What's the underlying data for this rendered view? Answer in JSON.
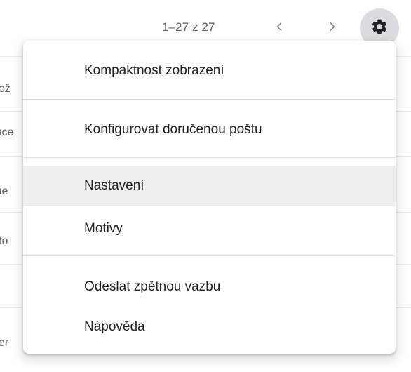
{
  "toolbar": {
    "pagination_text": "1–27 z 27",
    "prev_icon": "chevron-left-icon",
    "next_icon": "chevron-right-icon",
    "settings_icon": "gear-icon"
  },
  "background_list": {
    "row_fragments": [
      "ož",
      "ıce",
      "ıe",
      "fo",
      "",
      "er"
    ]
  },
  "menu": {
    "items": [
      {
        "label": "Kompaktnost zobrazení"
      },
      {
        "label": "Konfigurovat doručenou poštu"
      },
      {
        "label": "Nastavení",
        "highlighted": true
      },
      {
        "label": "Motivy"
      },
      {
        "label": "Odeslat zpětnou vazbu"
      },
      {
        "label": "Nápověda"
      }
    ]
  },
  "colors": {
    "settings_button_bg": "#dadce0",
    "menu_highlight": "#eeeeee",
    "text_primary": "#202124",
    "text_secondary": "#5f6368"
  }
}
